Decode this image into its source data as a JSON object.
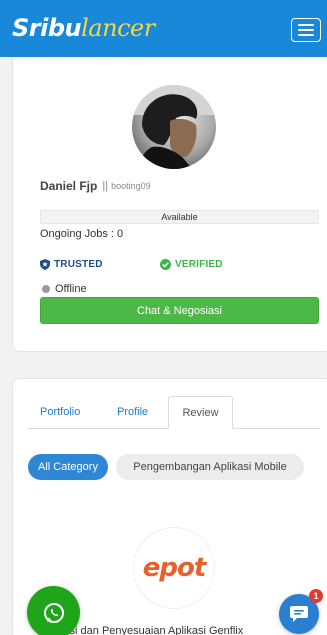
{
  "navbar": {
    "logo_part1": "Sribu",
    "logo_part2": "lancer",
    "colors": {
      "bar": "#1a88d8",
      "logo_accent": "#f7d63a"
    }
  },
  "profile": {
    "name": "Daniel Fjp",
    "separator": "||",
    "username": "booting09",
    "availability": "Available",
    "ongoing_jobs": "Ongoing Jobs : 0",
    "badges": {
      "trusted": "TRUSTED",
      "verified": "VERIFIED"
    },
    "status": "Offline",
    "chat_button": "Chat & Negosiasi"
  },
  "tabs": [
    {
      "label": "Portfolio",
      "active": false
    },
    {
      "label": "Profile",
      "active": false
    },
    {
      "label": "Review",
      "active": true
    }
  ],
  "categories": [
    {
      "label": "All Category",
      "selected": true
    },
    {
      "label": "Pengembangan Aplikasi Mobile",
      "selected": false
    }
  ],
  "project": {
    "logo_text": "epot",
    "title": "ifikasi dan Penyesuaian Aplikasi Genflix"
  },
  "notifications": {
    "count": "1"
  }
}
